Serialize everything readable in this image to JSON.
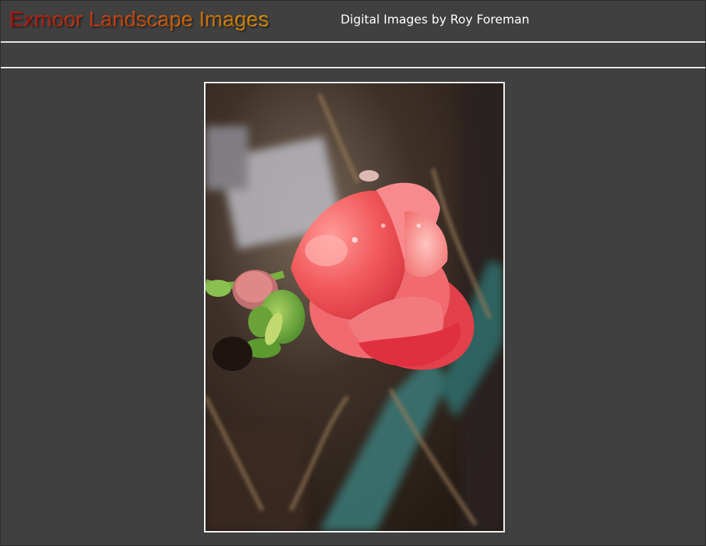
{
  "header": {
    "title": "Exmoor Landscape Images",
    "byline": "Digital Images by Roy Foreman"
  },
  "colors": {
    "background": "#404040",
    "rule": "#f2f2f2",
    "title_gradient_start": "#c8140f",
    "title_gradient_end": "#f0a20a",
    "byline": "#ffffff"
  },
  "photo": {
    "subject": "red-flower-bud-icon"
  }
}
